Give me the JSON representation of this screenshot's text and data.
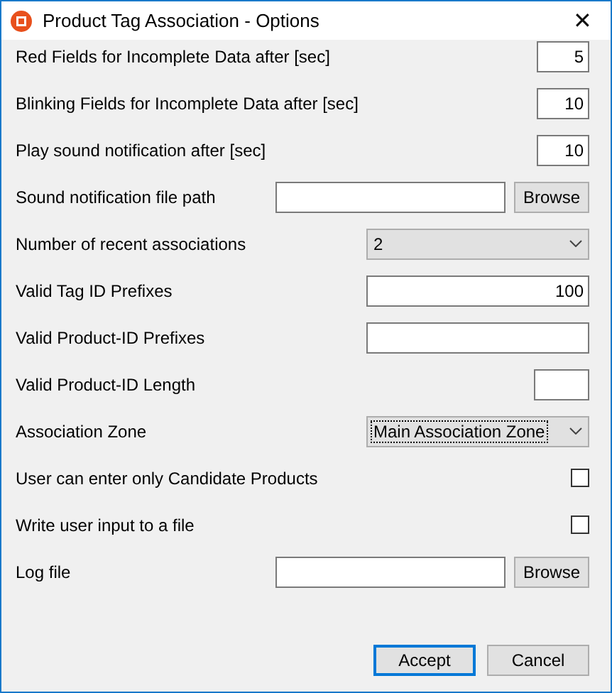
{
  "window": {
    "title": "Product Tag Association - Options",
    "close": "✕"
  },
  "rows": [
    {
      "label": "Red Fields for Incomplete Data after [sec]",
      "kind": "number",
      "value": "5"
    },
    {
      "label": "Blinking Fields for Incomplete Data after [sec]",
      "kind": "number",
      "value": "10"
    },
    {
      "label": "Play sound notification after [sec]",
      "kind": "number",
      "value": "10"
    },
    {
      "label": "Sound notification file path",
      "kind": "path",
      "button": "Browse"
    },
    {
      "label": "Number of recent associations",
      "kind": "combo",
      "value": "2",
      "focused": false
    },
    {
      "label": "Valid Tag ID Prefixes",
      "kind": "text",
      "value": "100"
    },
    {
      "label": "Valid Product-ID Prefixes",
      "kind": "text"
    },
    {
      "label": "Valid Product-ID Length",
      "kind": "short"
    },
    {
      "label": "Association Zone",
      "kind": "combo",
      "value": "Main Association Zone",
      "focused": true
    },
    {
      "label": "User can enter only Candidate Products",
      "kind": "checkbox",
      "checked": false
    },
    {
      "label": "Write user input to a file",
      "kind": "checkbox",
      "checked": false
    },
    {
      "label": "Log file",
      "kind": "path",
      "button": "Browse"
    }
  ],
  "buttons": [
    {
      "label": "Accept",
      "default": true
    },
    {
      "label": "Cancel",
      "default": false
    }
  ]
}
